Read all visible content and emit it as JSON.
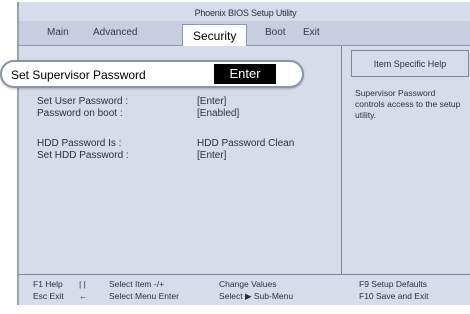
{
  "window": {
    "title": "Phoenix BIOS Setup Utility"
  },
  "menu": {
    "items": [
      "Main",
      "Advanced",
      "Security",
      "Boot",
      "Exit"
    ],
    "active": "Security"
  },
  "highlight": {
    "label": "Set Supervisor Password",
    "value": "Enter"
  },
  "settings": [
    {
      "label": "Set User Password :",
      "value": "[Enter]"
    },
    {
      "label": "Password on boot :",
      "value": "[Enabled]"
    },
    {
      "label": "HDD Password Is :",
      "value": "HDD Password Clean"
    },
    {
      "label": "Set HDD Password :",
      "value": "[Enter]"
    }
  ],
  "help": {
    "header": "Item Specific Help",
    "text": "Supervisor Password controls access to the setup utility."
  },
  "footer": {
    "row1": [
      "F1 Help",
      "| |",
      "Select Item -/+",
      "Change Values",
      "F9 Setup Defaults"
    ],
    "row2": [
      "Esc Exit",
      "←",
      "Select Menu Enter",
      "Select ▶ Sub-Menu",
      "F10 Save and Exit"
    ]
  },
  "colors": {
    "screen_bg": "#d7dcea",
    "active_tab_bg": "#ffffff",
    "value_highlight_bg": "#000000"
  }
}
